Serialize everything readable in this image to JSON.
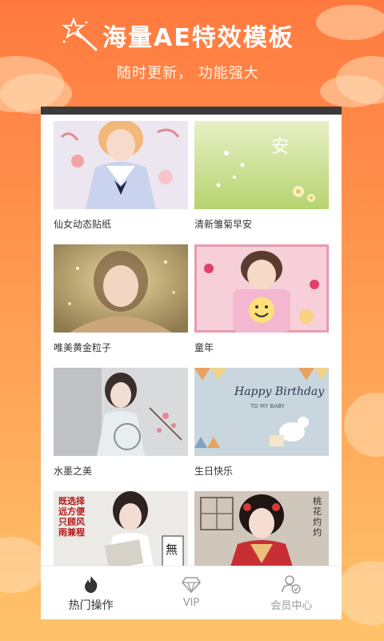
{
  "header": {
    "headline": "海量AE特效模板",
    "subline": "随时更新， 功能强大"
  },
  "templates": [
    {
      "title": "仙女动态贴纸",
      "thumb_icon": "sailor-girl-photo"
    },
    {
      "title": "清新雏菊早安",
      "thumb_icon": "daisy-morning-photo",
      "overlay_text": "安"
    },
    {
      "title": "唯美黄金粒子",
      "thumb_icon": "golden-particles-photo"
    },
    {
      "title": "童年",
      "thumb_icon": "childhood-photo"
    },
    {
      "title": "水墨之美",
      "thumb_icon": "ink-wash-photo"
    },
    {
      "title": "生日快乐",
      "thumb_icon": "birthday-card-photo",
      "overlay_text": "Happy Birthday",
      "overlay_sub": "TO MY BABY"
    },
    {
      "title": "",
      "thumb_icon": "student-calligraphy-photo",
      "overlay_text": "既选择远方便只顾风雨兼程",
      "stamp_text": "無"
    },
    {
      "title": "",
      "thumb_icon": "hanfu-girl-photo",
      "overlay_text": "桃花灼灼"
    }
  ],
  "bottom_nav": [
    {
      "label": "热门操作",
      "icon": "flame-icon",
      "active": true
    },
    {
      "label": "VIP",
      "icon": "diamond-icon",
      "active": false
    },
    {
      "label": "会员中心",
      "icon": "user-check-icon",
      "active": false
    }
  ],
  "colors": {
    "background_top": "#ff7a3f",
    "background_bottom": "#ffc36b",
    "card_bg": "#ffffff",
    "text_dark": "#333333",
    "text_muted": "#9a9a9a"
  }
}
